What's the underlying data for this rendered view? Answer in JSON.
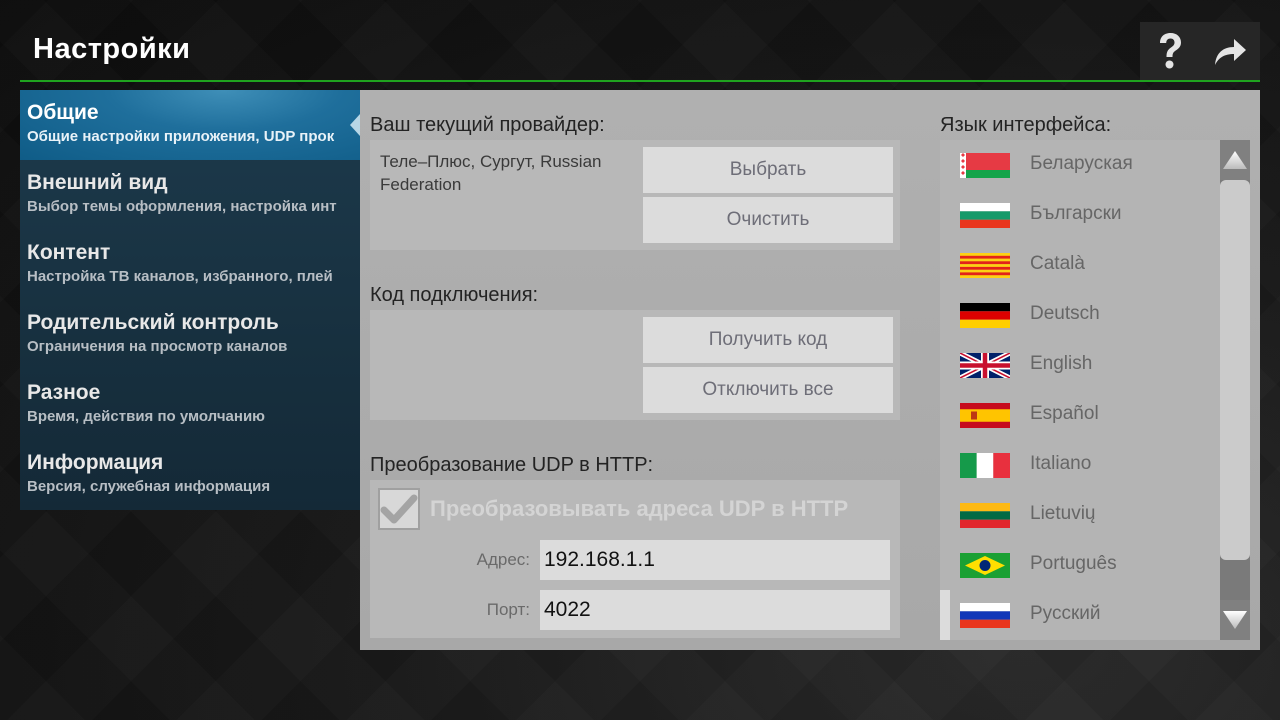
{
  "header": {
    "title": "Настройки",
    "help_icon": "question-mark-icon",
    "exit_icon": "share-arrow-icon",
    "accent_color": "#1fa31f"
  },
  "sidebar": {
    "items": [
      {
        "title": "Общие",
        "subtitle": "Общие настройки приложения, UDP прок",
        "active": true
      },
      {
        "title": "Внешний вид",
        "subtitle": "Выбор темы оформления, настройка инт",
        "active": false
      },
      {
        "title": "Контент",
        "subtitle": "Настройка ТВ каналов, избранного, плей",
        "active": false
      },
      {
        "title": "Родительский контроль",
        "subtitle": "Ограничения на просмотр каналов",
        "active": false
      },
      {
        "title": "Разное",
        "subtitle": "Время, действия по умолчанию",
        "active": false
      },
      {
        "title": "Информация",
        "subtitle": "Версия, служебная информация",
        "active": false
      }
    ]
  },
  "provider": {
    "label": "Ваш текущий провайдер:",
    "value": "Теле–Плюс, Сургут, Russian Federation",
    "select_button": "Выбрать",
    "clear_button": "Очистить"
  },
  "connection": {
    "label": "Код подключения:",
    "get_code_button": "Получить код",
    "disconnect_all_button": "Отключить все"
  },
  "udp": {
    "label": "Преобразование UDP в HTTP:",
    "checkbox_label": "Преобразовывать адреса UDP в HTTP",
    "checkbox_checked": true,
    "address_label": "Адрес:",
    "address_value": "192.168.1.1",
    "port_label": "Порт:",
    "port_value": "4022"
  },
  "language": {
    "label": "Язык интерфейса:",
    "items": [
      {
        "name": "Беларуская",
        "flag": "belarus-flag"
      },
      {
        "name": "Български",
        "flag": "bulgaria-flag"
      },
      {
        "name": "Català",
        "flag": "catalonia-flag"
      },
      {
        "name": "Deutsch",
        "flag": "germany-flag"
      },
      {
        "name": "English",
        "flag": "uk-flag"
      },
      {
        "name": "Español",
        "flag": "spain-flag"
      },
      {
        "name": "Italiano",
        "flag": "italy-flag"
      },
      {
        "name": "Lietuvių",
        "flag": "lithuania-flag"
      },
      {
        "name": "Português",
        "flag": "brazil-flag"
      },
      {
        "name": "Русский",
        "flag": "russia-flag",
        "selected": true
      }
    ]
  }
}
